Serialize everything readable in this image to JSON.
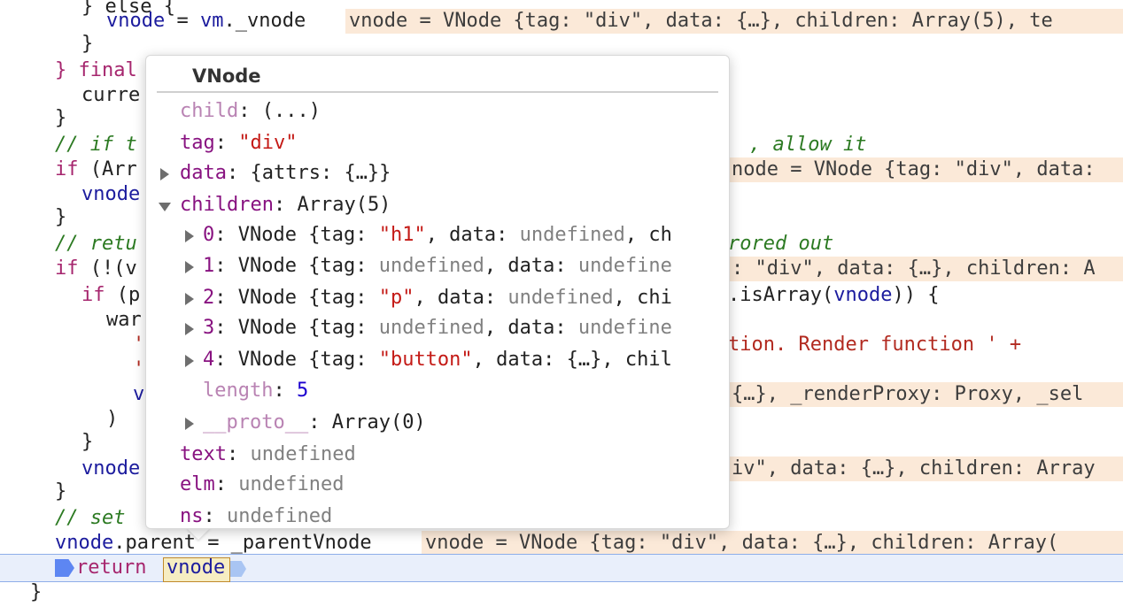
{
  "code": {
    "l_else": "} else {",
    "l_vm_vnode_a": "vnode",
    "l_vm_vnode_b": " = ",
    "l_vm_vnode_c": "vm",
    "l_vm_vnode_d": "._vnode",
    "l_close1": "}",
    "l_finally_kw": "} final",
    "l_curre": "curre",
    "l_close2": "}",
    "l_cmt1": "// if t",
    "l_cmt1_tail": ", allow it",
    "l_if_arr": "if (Arr",
    "l_vnode_assign": "vnode",
    "l_close3": "}",
    "l_cmt2": "// retu",
    "l_cmt2_tail": "rored out",
    "l_if_not": "if (!(v",
    "l_if_p": "if (p",
    "l_isarray_tail_a": ".isArray(",
    "l_isarray_tail_b": "vnode",
    "l_isarray_tail_c": ")) {",
    "l_warn": "war",
    "l_quote1": "'",
    "l_tion_a": "tion. Render function ' +",
    "l_quote2": "'",
    "l_v": "v",
    "l_paren": ")",
    "l_close4": "}",
    "l_vnode_assign2": "vnode",
    "l_close5": "}",
    "l_cmt3": "// set",
    "l_parent_a": "vnode",
    "l_parent_b": ".parent = _parentVnode",
    "l_return_kw": "return",
    "l_return_var": "vnode",
    "l_final_close": "}"
  },
  "inline_values": {
    "top": "vnode = VNode {tag: \"div\", data: {…}, children: Array(5), te",
    "row5": "node = VNode {tag: \"div\", data:",
    "row8": ": \"div\", data: {…}, children: A",
    "row12": "{…}, _renderProxy: Proxy, _sel",
    "row14": "iv\", data: {…}, children: Array",
    "row17": "vnode = VNode {tag: \"div\", data: {…}, children: Array("
  },
  "popover": {
    "title": "VNode",
    "props": {
      "child_name": "child",
      "child_val": "(...)",
      "tag_name": "tag",
      "tag_val": "\"div\"",
      "data_name": "data",
      "data_val": "{attrs: {…}}",
      "children_name": "children",
      "children_val": "Array(5)",
      "items": [
        {
          "idx": "0",
          "pre": "VNode {tag: ",
          "tag": "\"h1\"",
          "mid": ", data: ",
          "data": "undefined",
          "post": ", ch"
        },
        {
          "idx": "1",
          "pre": "VNode {tag: ",
          "tag": "undefined",
          "mid": ", data: ",
          "data": "undefine",
          "post": ""
        },
        {
          "idx": "2",
          "pre": "VNode {tag: ",
          "tag": "\"p\"",
          "mid": ", data: ",
          "data": "undefined",
          "post": ", chi"
        },
        {
          "idx": "3",
          "pre": "VNode {tag: ",
          "tag": "undefined",
          "mid": ", data: ",
          "data": "undefine",
          "post": ""
        },
        {
          "idx": "4",
          "pre": "VNode {tag: ",
          "tag": "\"button\"",
          "mid": ", data: ",
          "data": "{…}",
          "post": ", chil"
        }
      ],
      "length_name": "length",
      "length_val": "5",
      "proto_name": "__proto__",
      "proto_val": "Array(0)",
      "text_name": "text",
      "text_val": "undefined",
      "elm_name": "elm",
      "elm_val": "undefined",
      "ns_name": "ns",
      "ns_val": "undefined"
    }
  },
  "colors": {
    "keyword": "#a6266e",
    "variable": "#1c1c9e",
    "string": "#b22a20",
    "comment": "#2c7a22",
    "inline_bg": "#fbe9d8",
    "exec_line_bg": "#e9effb",
    "breakpoint": "#5d86f2"
  }
}
